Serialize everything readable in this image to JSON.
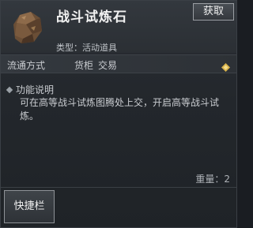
{
  "item": {
    "name": "战斗试炼石",
    "type_label": "类型：活动道具",
    "icon": "rock-stone-icon"
  },
  "buttons": {
    "get": "获取",
    "quick_bar": "快捷栏"
  },
  "circulation": {
    "label": "流通方式",
    "values": [
      "货柜",
      "交易"
    ],
    "icon": "diamond-icon"
  },
  "description": {
    "heading": "功能说明",
    "text": "可在高等战斗试炼图腾处上交，开启高等战斗试炼。"
  },
  "weight": "重量：2",
  "colors": {
    "title": "#f2f2f2",
    "text": "#c9ccd0",
    "accent_gold": "#d8b24a"
  }
}
